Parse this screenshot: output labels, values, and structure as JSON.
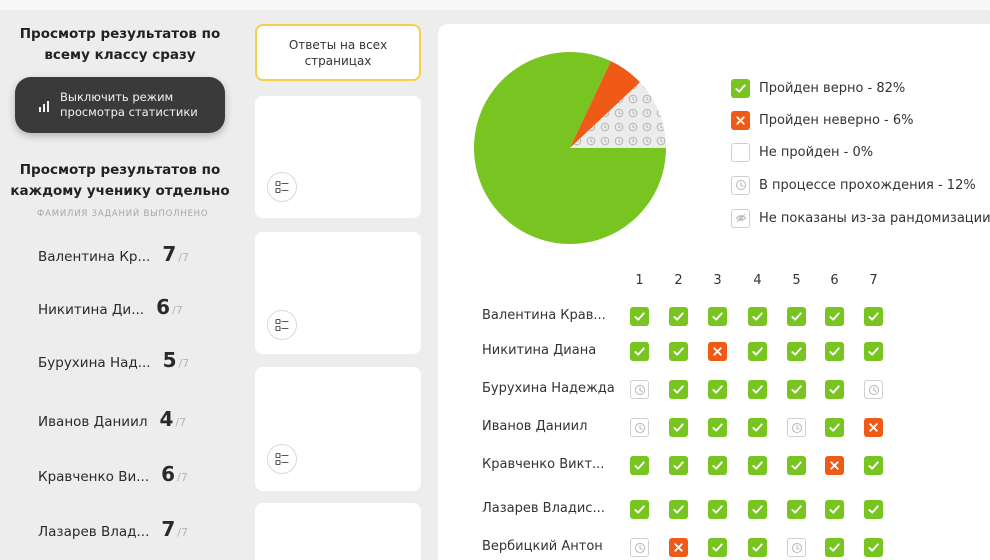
{
  "colors": {
    "correct": "#78c522",
    "wrong": "#ef5a17",
    "progress_fill": "#e6e6e6",
    "dark_button": "#3a3a3a",
    "selected_border": "#f6d04d"
  },
  "left": {
    "class_title": "Просмотр результатов по всему классу сразу",
    "stats_button": "Выключить режим\nпросмотра статистики",
    "student_title": "Просмотр результатов по каждому ученику отдельно",
    "caption": "ФАМИЛИЯ ЗАДАНИЙ ВЫПОЛНЕНО",
    "students": [
      {
        "name": "Валентина Кр...",
        "score": "7",
        "total": "/7"
      },
      {
        "name": "Никитина Ди...",
        "score": "6",
        "total": "/7"
      },
      {
        "name": "Бурухина Над...",
        "score": "5",
        "total": "/7"
      },
      {
        "name": "Иванов Даниил",
        "score": "4",
        "total": "/7"
      },
      {
        "name": "Кравченко Ви...",
        "score": "6",
        "total": "/7"
      },
      {
        "name": "Лазарев Влад...",
        "score": "7",
        "total": "/7"
      }
    ]
  },
  "pages": {
    "all_label": "Ответы на всех\nстраницах",
    "card_icon": "list-icon"
  },
  "stats": {
    "pie": {
      "correct": 82,
      "wrong": 6,
      "not_passed": 0,
      "in_progress": 12
    },
    "legend": [
      {
        "status": "correct",
        "icon": "check-icon",
        "label": "Пройден верно - 82%"
      },
      {
        "status": "wrong",
        "icon": "cross-icon",
        "label": "Пройден неверно - 6%"
      },
      {
        "status": "empty",
        "icon": "",
        "label": "Не пройден - 0%"
      },
      {
        "status": "progress",
        "icon": "clock-icon",
        "label": "В процессе прохождения - 12%"
      },
      {
        "status": "hidden",
        "icon": "eye-off-icon",
        "label": "Не показаны из-за рандомизации"
      }
    ],
    "columns": [
      "1",
      "2",
      "3",
      "4",
      "5",
      "6",
      "7"
    ],
    "rows": [
      {
        "name": "Валентина Крав...",
        "cells": [
          "correct",
          "correct",
          "correct",
          "correct",
          "correct",
          "correct",
          "correct"
        ]
      },
      {
        "name": "Никитина Диана",
        "cells": [
          "correct",
          "correct",
          "wrong",
          "correct",
          "correct",
          "correct",
          "correct"
        ]
      },
      {
        "name": "Бурухина Надежда",
        "cells": [
          "progress",
          "correct",
          "correct",
          "correct",
          "correct",
          "correct",
          "progress"
        ]
      },
      {
        "name": "Иванов Даниил",
        "cells": [
          "progress",
          "correct",
          "correct",
          "correct",
          "progress",
          "correct",
          "wrong"
        ]
      },
      {
        "name": "Кравченко Викт...",
        "cells": [
          "correct",
          "correct",
          "correct",
          "correct",
          "correct",
          "wrong",
          "correct"
        ]
      },
      {
        "name": "Лазарев Владис...",
        "cells": [
          "correct",
          "correct",
          "correct",
          "correct",
          "correct",
          "correct",
          "correct"
        ]
      },
      {
        "name": "Вербицкий Антон",
        "cells": [
          "progress",
          "wrong",
          "correct",
          "correct",
          "progress",
          "correct",
          "correct"
        ]
      }
    ]
  }
}
